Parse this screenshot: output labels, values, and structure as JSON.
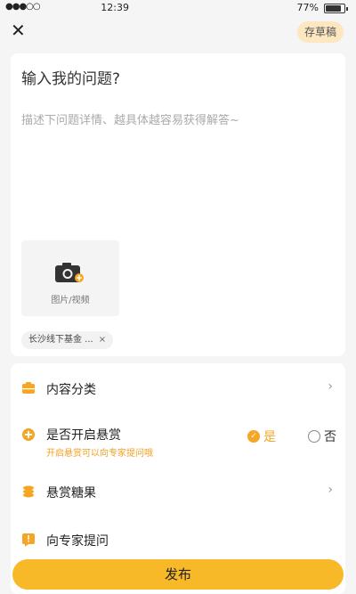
{
  "status_bar": {
    "signal": "●●●○○",
    "time": "12:39",
    "battery_percent": "77%",
    "battery_level": 0.77
  },
  "header": {
    "close_glyph": "✕",
    "save_draft_label": "存草稿"
  },
  "form": {
    "title_placeholder": "输入我的问题?",
    "description_placeholder": "描述下问题详情、越具体越容易获得解答~",
    "media_label": "图片/视频",
    "tag_label": "长沙线下基金 ...",
    "tag_close": "×"
  },
  "options": {
    "category_label": "内容分类",
    "reward_label": "是否开启悬赏",
    "reward_hint": "开启悬赏可以向专家提问哦",
    "reward_yes": "是",
    "reward_no": "否",
    "reward_selected": "是",
    "candy_label": "悬赏糖果",
    "expert_label": "向专家提问",
    "chevron": "›"
  },
  "footer": {
    "publish_label": "发布"
  },
  "colors": {
    "accent": "#f5a623",
    "publish_button": "#f7b928",
    "draft_button": "#fce7c1"
  },
  "icons": {
    "close": "close-icon",
    "camera": "camera-icon",
    "category": "category-icon",
    "reward": "reward-icon",
    "candy": "candy-icon",
    "expert": "expert-icon",
    "chevron": "chevron-right-icon"
  }
}
